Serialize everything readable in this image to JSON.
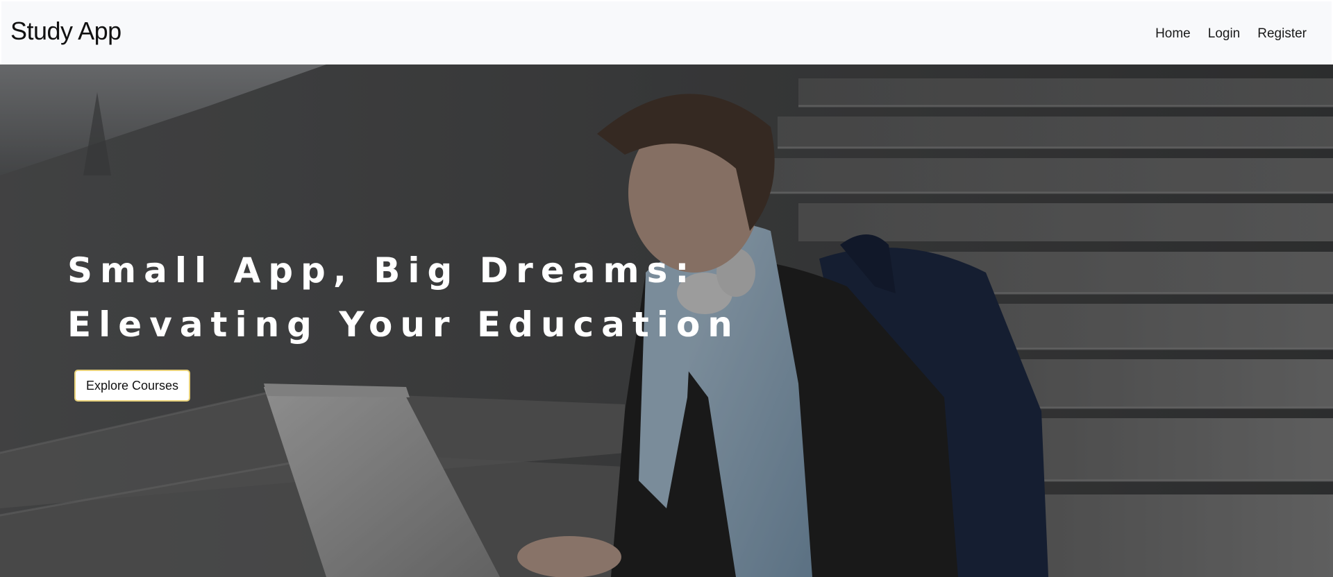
{
  "navbar": {
    "brand": "Study App",
    "links": [
      {
        "label": "Home"
      },
      {
        "label": "Login"
      },
      {
        "label": "Register"
      }
    ]
  },
  "hero": {
    "title_line1": "Small App, Big Dreams:",
    "title_line2": "Elevating Your Education",
    "cta_label": "Explore Courses",
    "background": "photo-student-with-laptop-on-stairs"
  },
  "colors": {
    "navbar_bg": "#f8f9fb",
    "hero_text": "#ffffff",
    "button_border": "#e9d27a"
  }
}
